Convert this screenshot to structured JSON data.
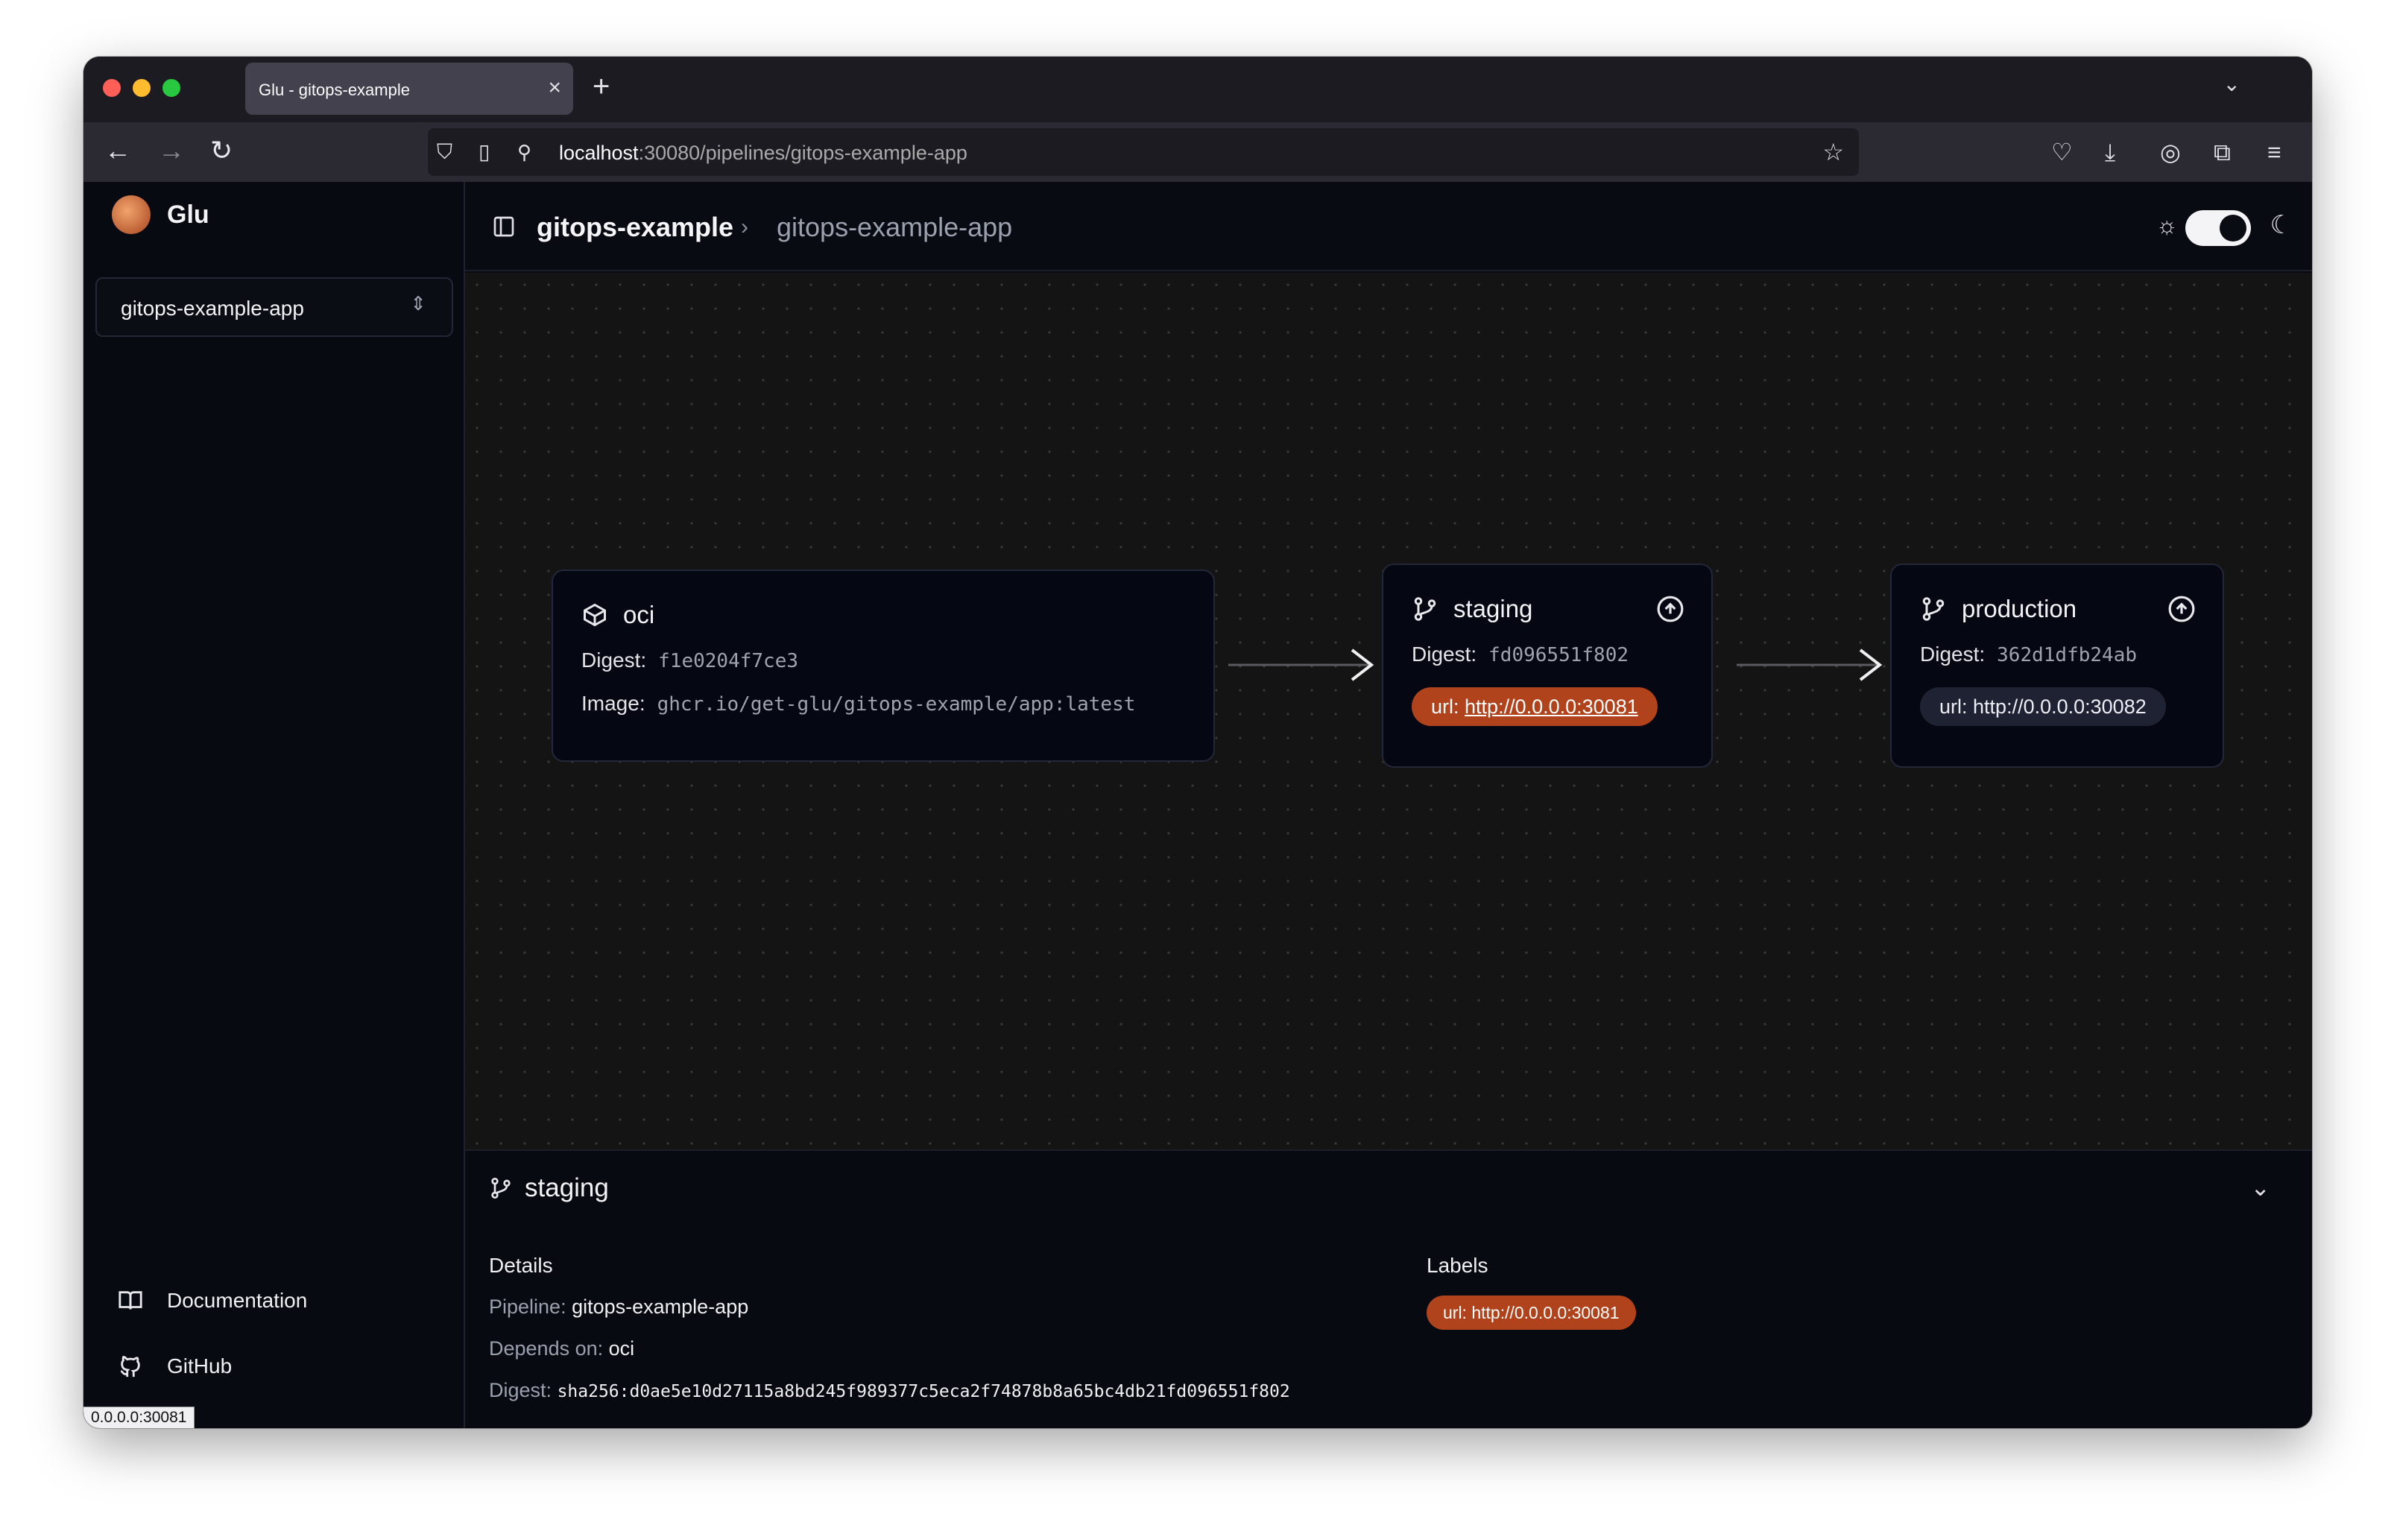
{
  "browser": {
    "tab_title": "Glu - gitops-example",
    "url_host": "localhost",
    "url_rest": ":30080/pipelines/gitops-example-app",
    "status_url": "0.0.0.0:30081"
  },
  "sidebar": {
    "brand": "Glu",
    "pipeline_selector": "gitops-example-app",
    "links": [
      {
        "label": "Documentation",
        "icon": "book-icon"
      },
      {
        "label": "GitHub",
        "icon": "github-icon"
      }
    ]
  },
  "header": {
    "crumb_root": "gitops-example",
    "crumb_separator": "›",
    "crumb_current": "gitops-example-app"
  },
  "graph": {
    "nodes": [
      {
        "id": "oci",
        "title": "oci",
        "icon": "package-icon",
        "digest_label": "Digest:",
        "digest": "f1e0204f7ce3",
        "image_label": "Image:",
        "image": "ghcr.io/get-glu/gitops-example/app:latest"
      },
      {
        "id": "staging",
        "title": "staging",
        "icon": "git-branch-icon",
        "digest_label": "Digest:",
        "digest": "fd096551f802",
        "label_key": "url:",
        "label_value": "http://0.0.0.0:30081",
        "selected": true
      },
      {
        "id": "production",
        "title": "production",
        "icon": "git-branch-icon",
        "digest_label": "Digest:",
        "digest": "362d1dfb24ab",
        "label_key": "url:",
        "label_value": "http://0.0.0.0:30082"
      }
    ],
    "edges": [
      [
        "oci",
        "staging"
      ],
      [
        "staging",
        "production"
      ]
    ],
    "controls": [
      "zoom-in",
      "zoom-out",
      "fit-view",
      "lock"
    ]
  },
  "details_panel": {
    "title": "staging",
    "details_heading": "Details",
    "pipeline_key": "Pipeline:",
    "pipeline_value": "gitops-example-app",
    "depends_key": "Depends on:",
    "depends_value": "oci",
    "digest_key": "Digest:",
    "digest_value": "sha256:d0ae5e10d27115a8bd245f989377c5eca2f74878b8a65bc4db21fd096551f802",
    "labels_heading": "Labels",
    "label_pill": "url: http://0.0.0.0:30081"
  },
  "colors": {
    "accent_orange": "#b0431c",
    "background": "#090b12",
    "canvas": "#141414"
  }
}
